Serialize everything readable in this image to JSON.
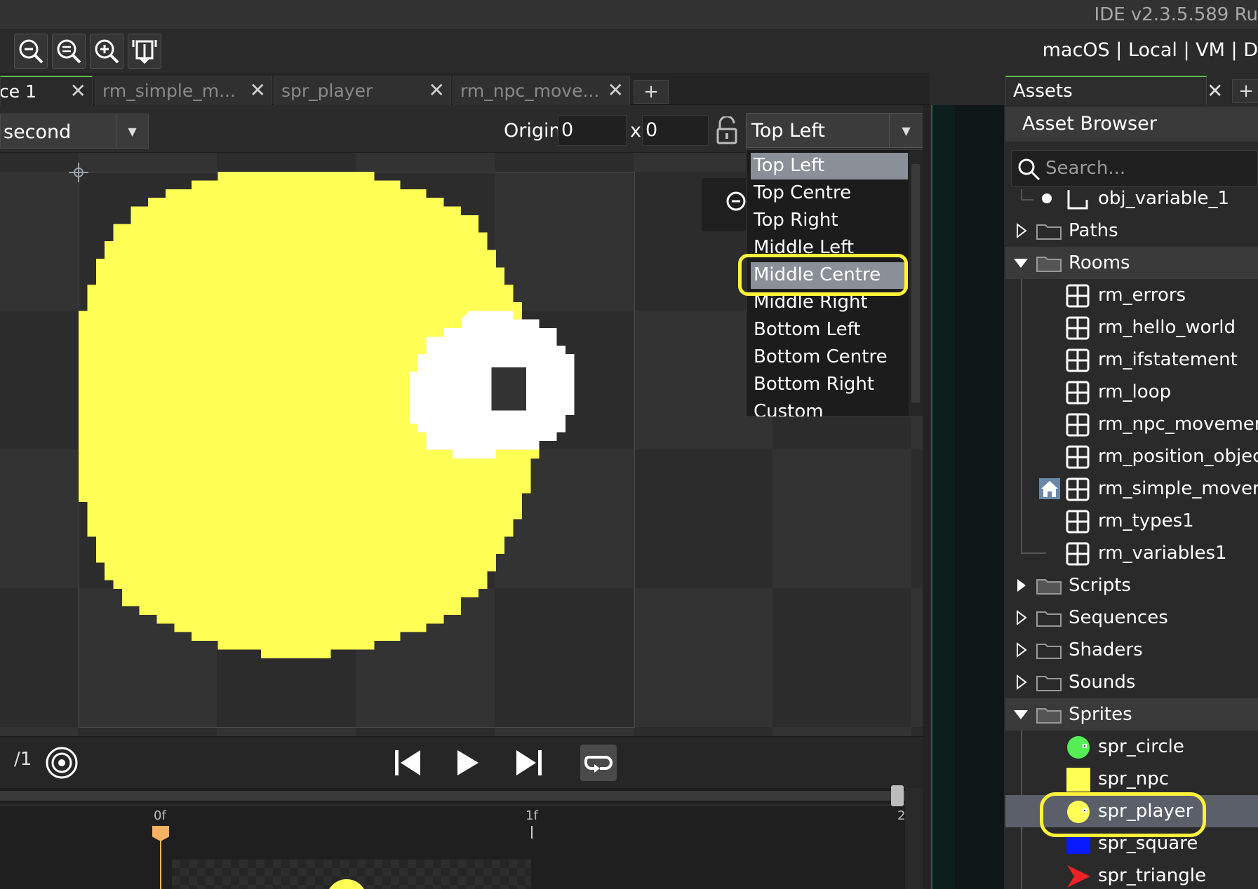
{
  "window": {
    "ide_version": "IDE v2.3.5.589  Ru"
  },
  "toolbar": {
    "buttons": [
      "zoom-out-icon",
      "zoom-reset-icon",
      "zoom-in-icon",
      "fit-icon"
    ],
    "platform_text": "macOS | Local | VM | D"
  },
  "tabs": [
    {
      "label": "ce 1",
      "active": true
    },
    {
      "label": "rm_simple_m...",
      "active": false
    },
    {
      "label": "spr_player",
      "active": false
    },
    {
      "label": "rm_npc_move...",
      "active": false
    }
  ],
  "tab_add_label": "+",
  "editor": {
    "frame_select": "second",
    "origin_label": "Origin",
    "origin_x": "0",
    "origin_sep": "x",
    "origin_y": "0",
    "origin_mode": "Top Left",
    "origin_options": [
      "Top Left",
      "Top Centre",
      "Top Right",
      "Middle Left",
      "Middle Centre",
      "Middle Right",
      "Bottom Left",
      "Bottom Centre",
      "Bottom Right",
      "Custom"
    ],
    "origin_highlighted": "Middle Centre"
  },
  "sprite": {
    "body_color": "#ffff55",
    "eye_color": "#ffffff",
    "pupil_color": "#333333"
  },
  "playback": {
    "frame_total": "/1",
    "timeline_ticks": [
      "0f",
      "1f",
      "2"
    ]
  },
  "assets": {
    "tab_label": "Assets",
    "tab_close": "✕",
    "add_label": "+",
    "browser_title": "Asset Browser",
    "search_placeholder": "Search...",
    "tree": [
      {
        "label": "obj_variable_1",
        "kind": "object",
        "depth": 1
      },
      {
        "label": "Paths",
        "kind": "folder",
        "open": false
      },
      {
        "label": "Rooms",
        "kind": "folder",
        "open": true
      },
      {
        "label": "rm_errors",
        "kind": "room"
      },
      {
        "label": "rm_hello_world",
        "kind": "room"
      },
      {
        "label": "rm_ifstatement",
        "kind": "room"
      },
      {
        "label": "rm_loop",
        "kind": "room"
      },
      {
        "label": "rm_npc_movement",
        "kind": "room"
      },
      {
        "label": "rm_position_object",
        "kind": "room"
      },
      {
        "label": "rm_simple_movem",
        "kind": "room",
        "home": true
      },
      {
        "label": "rm_types1",
        "kind": "room"
      },
      {
        "label": "rm_variables1",
        "kind": "room"
      },
      {
        "label": "Scripts",
        "kind": "folder",
        "open": false
      },
      {
        "label": "Sequences",
        "kind": "folder",
        "open": false
      },
      {
        "label": "Shaders",
        "kind": "folder",
        "open": false
      },
      {
        "label": "Sounds",
        "kind": "folder",
        "open": false
      },
      {
        "label": "Sprites",
        "kind": "folder",
        "open": true
      },
      {
        "label": "spr_circle",
        "kind": "sprite",
        "icon": "green-circle"
      },
      {
        "label": "spr_npc",
        "kind": "sprite",
        "icon": "yellow-square"
      },
      {
        "label": "spr_player",
        "kind": "sprite",
        "icon": "yellow-circle",
        "selected": true
      },
      {
        "label": "spr_square",
        "kind": "sprite",
        "icon": "blue-square"
      },
      {
        "label": "spr_triangle",
        "kind": "sprite",
        "icon": "red-arrow"
      }
    ]
  },
  "colors": {
    "accent_green": "#5fbf4a",
    "highlight_yellow": "#fff23a",
    "selection": "#5a5f69"
  }
}
